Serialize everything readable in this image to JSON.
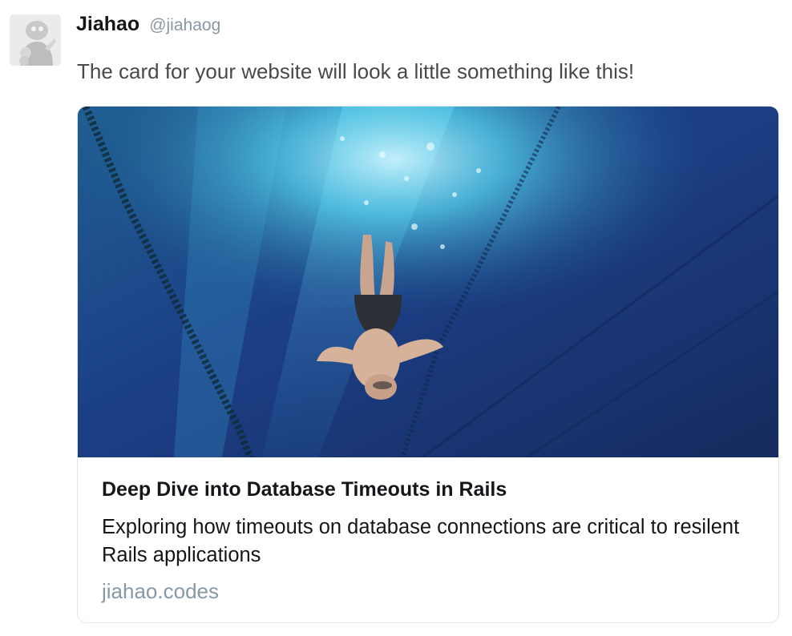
{
  "tweet": {
    "author_name": "Jiahao",
    "author_handle": "@jiahaog",
    "avatar_icon": "avatar-icon",
    "text": "The card for your website will look a little something like this!"
  },
  "card": {
    "image_icon": "underwater-swimmer-photo",
    "title": "Deep Dive into Database Timeouts in Rails",
    "description": "Exploring how timeouts on database connections are critical to resilent Rails applications",
    "domain": "jiahao.codes"
  },
  "colors": {
    "text_primary": "#14171a",
    "text_secondary": "#8899a6",
    "border": "#e1e8ed",
    "water_deep": "#1e3268",
    "water_light": "#5fd6f0"
  }
}
